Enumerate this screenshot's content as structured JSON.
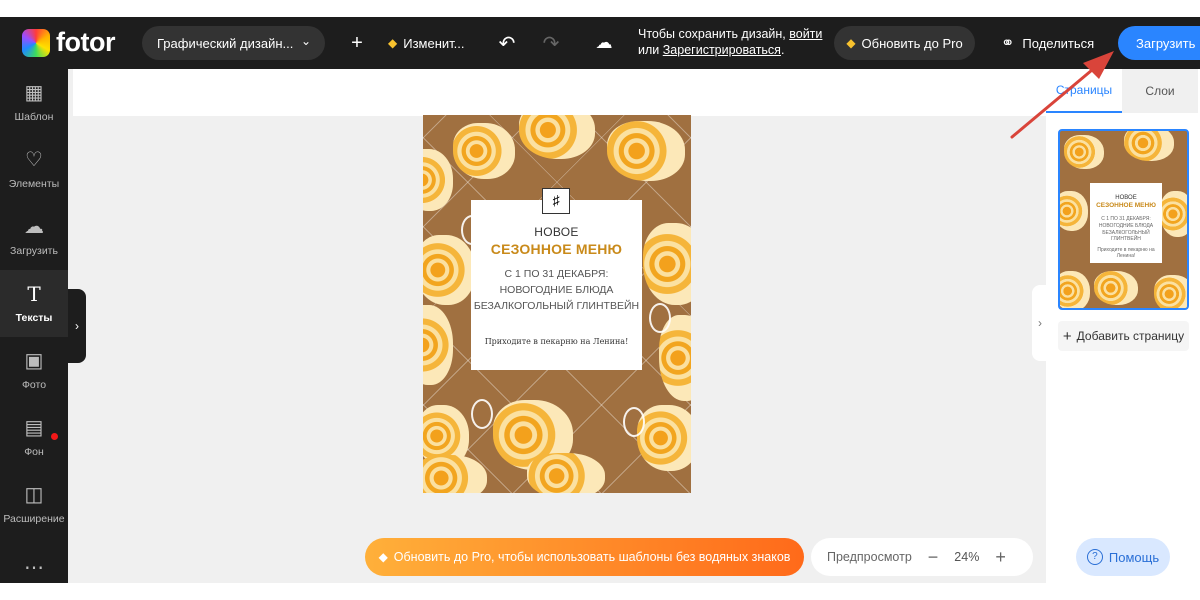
{
  "topbar": {
    "logo_text": "fotor",
    "design_type": "Графический дизайн...",
    "resize_label": "Изменит...",
    "save_note_prefix": "Чтобы сохранить дизайн,",
    "save_login": "войти",
    "save_or": "или",
    "save_register": "Зарегистрироваться",
    "save_dot": ".",
    "upgrade_label": "Обновить до Pro",
    "share_label": "Поделиться",
    "download_label": "Загрузить"
  },
  "sidebar": {
    "items": [
      {
        "label": "Шаблон",
        "icon": "template-icon"
      },
      {
        "label": "Элементы",
        "icon": "elements-icon"
      },
      {
        "label": "Загрузить",
        "icon": "upload-icon"
      },
      {
        "label": "Тексты",
        "icon": "text-icon"
      },
      {
        "label": "Фото",
        "icon": "photo-icon"
      },
      {
        "label": "Фон",
        "icon": "background-icon"
      },
      {
        "label": "Расширение",
        "icon": "extension-icon"
      }
    ]
  },
  "poster": {
    "line_new": "НОВОЕ",
    "title": "СЕЗОННОЕ МЕНЮ",
    "line1": "С 1 ПО 31 ДЕКАБРЯ:",
    "line2": "НОВОГОДНИЕ БЛЮДА",
    "line3": "БЕЗАЛКОГОЛЬНЫЙ ГЛИНТВЕЙН",
    "invite": "Приходите в пекарню на Ленина!"
  },
  "right_panel": {
    "tab_pages": "Страницы",
    "tab_layers": "Слои",
    "add_page": "Добавить страницу"
  },
  "bottom": {
    "pro_banner": "Обновить до Pro, чтобы использовать шаблоны без водяных знаков",
    "preview": "Предпросмотр",
    "zoom": "24%",
    "help": "Помощь"
  },
  "colors": {
    "accent": "#2a85ff",
    "poster_bg": "#a07040",
    "title_gold": "#c98a1a",
    "pro_gradient_start": "#ffb03a",
    "pro_gradient_end": "#ff6a1a",
    "annotation_arrow": "#d9443a"
  }
}
